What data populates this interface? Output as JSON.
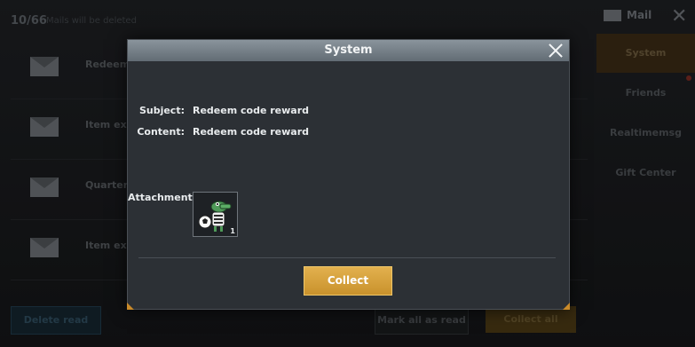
{
  "background": {
    "mail_count": "10/66",
    "mail_count_sub": "Mails will be deleted",
    "header_title": "Mail",
    "mail_rows": [
      {
        "text": "Redeem co"
      },
      {
        "text": "Item expire"
      },
      {
        "text": "Quarter Fin"
      },
      {
        "text": "Item expire"
      }
    ],
    "side_tabs": [
      {
        "label": "System"
      },
      {
        "label": "Friends"
      },
      {
        "label": "Realtimemsg"
      },
      {
        "label": "Gift Center"
      }
    ],
    "buttons": {
      "delete_read": "Delete read",
      "mark_all_read": "Mark all as read",
      "collect_all": "Collect all"
    }
  },
  "dialog": {
    "title": "System",
    "subject_label": "Subject:",
    "subject_value": "Redeem code reward",
    "content_label": "Content:",
    "content_value": "Redeem code reward",
    "attachment_label": "Attachment:",
    "attachment": {
      "icon": "crocodile-soccer-sticker-icon",
      "quantity": "1"
    },
    "collect_label": "Collect"
  },
  "colors": {
    "accent_gold": "#d9a13f",
    "header_grey": "#7a848c",
    "panel_bg": "#2c3035"
  }
}
